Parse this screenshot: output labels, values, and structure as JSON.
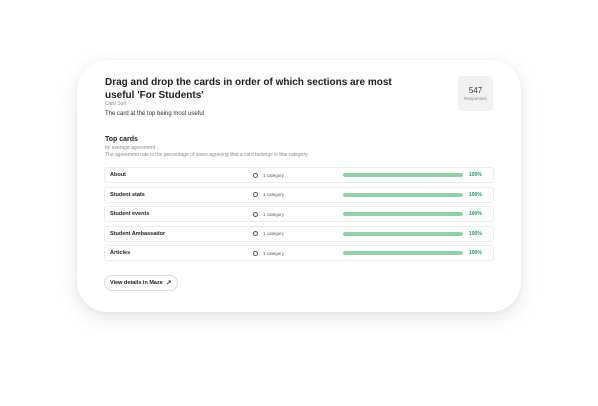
{
  "question": {
    "title": "Drag and drop the cards in order of which sections are most useful 'For Students'",
    "type": "Card Sort",
    "description": "The card at the top being most useful"
  },
  "responses": {
    "count": "547",
    "label": "Responses"
  },
  "top_cards": {
    "title": "Top cards",
    "subtitle": "by average agreement",
    "description": "The agreement rate is the percentage of users agreeing that a card belongs in this category.",
    "rows": [
      {
        "name": "About",
        "category": "1 category",
        "percent": "100%",
        "fraction": 1.0
      },
      {
        "name": "Student stats",
        "category": "1 category",
        "percent": "100%",
        "fraction": 1.0
      },
      {
        "name": "Student events",
        "category": "1 category",
        "percent": "100%",
        "fraction": 1.0
      },
      {
        "name": "Student Ambassador",
        "category": "1 category",
        "percent": "100%",
        "fraction": 1.0
      },
      {
        "name": "Articles",
        "category": "1 category",
        "percent": "100%",
        "fraction": 1.0
      }
    ]
  },
  "actions": {
    "view_details": "View details in Maze",
    "view_details_icon": "arrow-up-right-icon"
  },
  "colors": {
    "bar_fill": "#8fd1ab",
    "bar_track": "#e7f4ec",
    "percent_text": "#1f9a57"
  }
}
